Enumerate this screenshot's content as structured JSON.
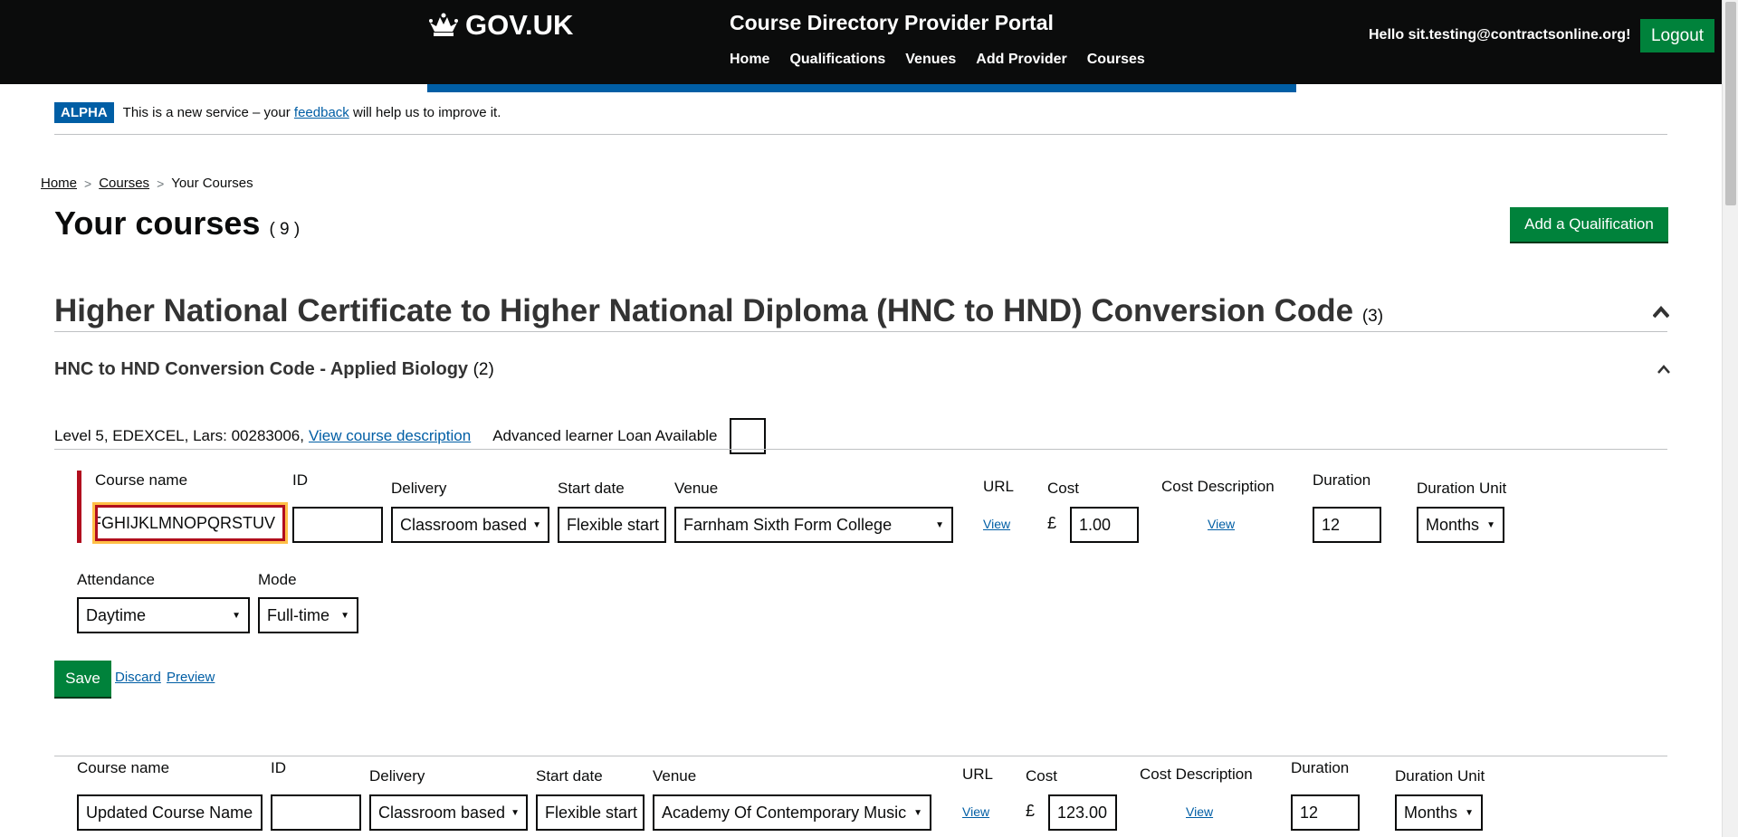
{
  "header": {
    "logo_text": "GOV.UK",
    "portal_title": "Course Directory Provider Portal",
    "nav": [
      "Home",
      "Qualifications",
      "Venues",
      "Add Provider",
      "Courses"
    ],
    "hello": "Hello sit.testing@contractsonline.org!",
    "logout": "Logout"
  },
  "phase": {
    "tag": "ALPHA",
    "text_before": "This is a new service – your",
    "link": "feedback",
    "text_after": "will help us to improve it."
  },
  "breadcrumb": [
    "Home",
    "Courses",
    "Your Courses"
  ],
  "page": {
    "title": "Your courses",
    "count": "( 9 )",
    "add_button": "Add a Qualification"
  },
  "qualification": {
    "title": "Higher National Certificate to Higher National Diploma (HNC to HND) Conversion Code",
    "count": "(3)",
    "sub_title": "HNC to HND Conversion Code - Applied Biology",
    "sub_count": "(2)",
    "meta": "Level 5, EDEXCEL, Lars: 00283006,",
    "view_desc": "View course description",
    "loan_label": "Advanced learner Loan Available"
  },
  "labels": {
    "course_name": "Course name",
    "id": "ID",
    "delivery": "Delivery",
    "start_date": "Start date",
    "venue": "Venue",
    "url": "URL",
    "cost": "Cost",
    "cost_desc": "Cost Description",
    "duration": "Duration",
    "duration_unit": "Duration Unit",
    "attendance": "Attendance",
    "mode": "Mode",
    "view": "View",
    "pound": "£"
  },
  "row1": {
    "course_name": "FGHIJKLMNOPQRSTUV",
    "id": "",
    "delivery": "Classroom based",
    "start_date": "Flexible start",
    "venue": "Farnham Sixth Form College",
    "cost": "1.00",
    "duration": "12",
    "duration_unit": "Months",
    "attendance": "Daytime",
    "mode": "Full-time"
  },
  "actions": {
    "save": "Save",
    "discard": "Discard",
    "preview": "Preview"
  },
  "row2": {
    "course_name": "Updated Course Name",
    "id": "",
    "delivery": "Classroom based",
    "start_date": "Flexible start",
    "venue": "Academy Of Contemporary Music",
    "cost": "123.00",
    "duration": "12",
    "duration_unit": "Months"
  },
  "colors": {
    "header_bg": "#0b0c0c",
    "brand_blue": "#005ea5",
    "button_green": "#00823b",
    "error_red": "#b10e1e",
    "focus_yellow": "#ffbf47"
  },
  "icons": [
    "crown-icon",
    "chevron-right-icon",
    "chevron-up-icon",
    "dropdown-caret-icon"
  ]
}
